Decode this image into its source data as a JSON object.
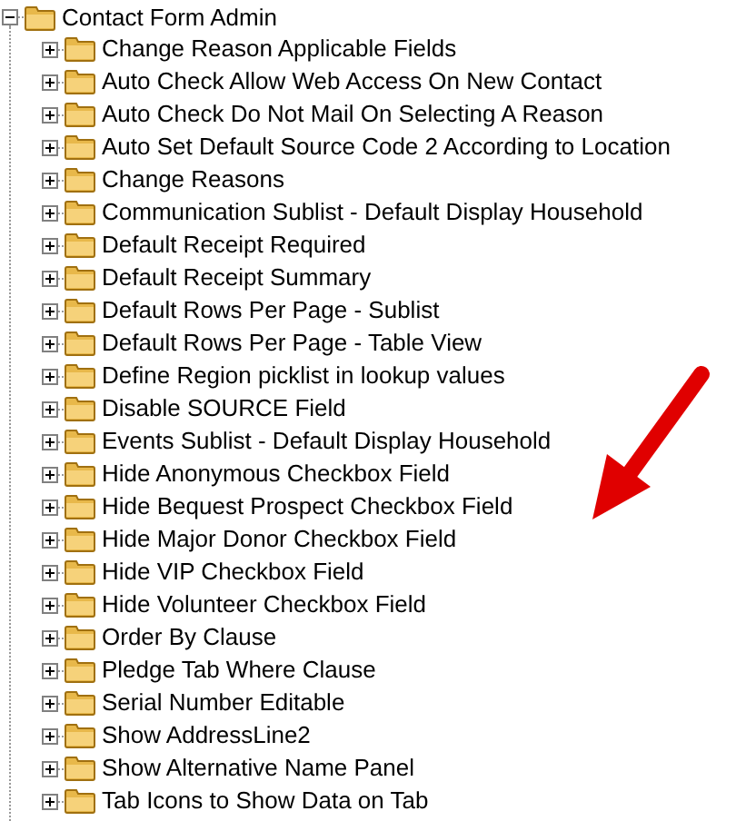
{
  "tree": {
    "label": "Contact Form Admin",
    "expanded": true,
    "children": [
      {
        "label": "Change Reason Applicable Fields",
        "expanded": false
      },
      {
        "label": "Auto Check Allow Web Access On New Contact",
        "expanded": false
      },
      {
        "label": "Auto Check Do Not Mail On Selecting A Reason",
        "expanded": false
      },
      {
        "label": "Auto Set Default Source Code 2 According to Location",
        "expanded": false
      },
      {
        "label": "Change Reasons",
        "expanded": false
      },
      {
        "label": "Communication Sublist - Default Display Household",
        "expanded": false
      },
      {
        "label": "Default Receipt Required",
        "expanded": false
      },
      {
        "label": "Default Receipt Summary",
        "expanded": false
      },
      {
        "label": "Default Rows Per Page - Sublist",
        "expanded": false
      },
      {
        "label": "Default Rows Per Page - Table View",
        "expanded": false
      },
      {
        "label": "Define Region picklist in lookup values",
        "expanded": false
      },
      {
        "label": "Disable SOURCE Field",
        "expanded": false
      },
      {
        "label": "Events Sublist - Default Display Household",
        "expanded": false
      },
      {
        "label": "Hide Anonymous Checkbox Field",
        "expanded": false
      },
      {
        "label": "Hide Bequest Prospect Checkbox Field",
        "expanded": false
      },
      {
        "label": "Hide Major Donor Checkbox Field",
        "expanded": false
      },
      {
        "label": "Hide VIP Checkbox Field",
        "expanded": false
      },
      {
        "label": "Hide Volunteer Checkbox Field",
        "expanded": false
      },
      {
        "label": "Order By Clause",
        "expanded": false
      },
      {
        "label": "Pledge Tab Where Clause",
        "expanded": false
      },
      {
        "label": "Serial Number Editable",
        "expanded": false
      },
      {
        "label": "Show AddressLine2",
        "expanded": false
      },
      {
        "label": "Show Alternative Name Panel",
        "expanded": false
      },
      {
        "label": "Tab Icons to Show Data on Tab",
        "expanded": false
      }
    ]
  }
}
